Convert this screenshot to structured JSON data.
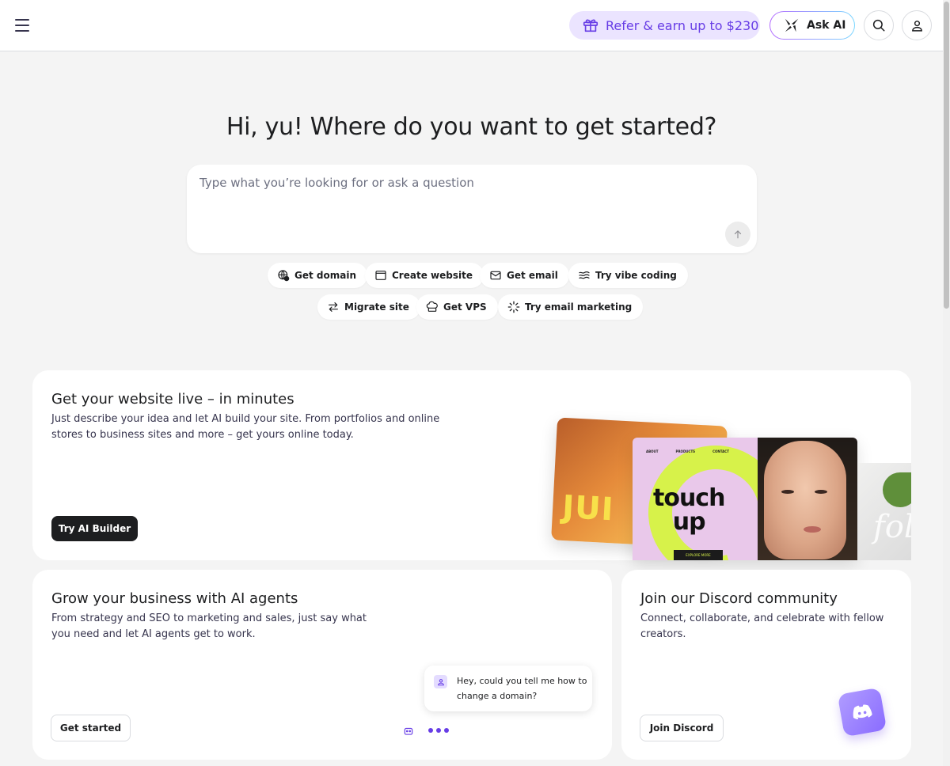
{
  "topbar": {
    "refer_label": "Refer & earn up to $230",
    "ask_ai_label": "Ask AI"
  },
  "hero": {
    "greeting": "Hi, yu! Where do you want to get started?",
    "ask_placeholder": "Type what you’re looking for or ask a question"
  },
  "quick_actions": [
    {
      "label": "Get domain",
      "icon": "globe-icon"
    },
    {
      "label": "Create website",
      "icon": "browser-window-icon"
    },
    {
      "label": "Get email",
      "icon": "mail-icon"
    },
    {
      "label": "Try vibe coding",
      "icon": "waves-icon"
    },
    {
      "label": "Migrate site",
      "icon": "swap-arrows-icon"
    },
    {
      "label": "Get VPS",
      "icon": "cloud-server-icon"
    },
    {
      "label": "Try email marketing",
      "icon": "sparkle-loader-icon"
    }
  ],
  "cards": {
    "website": {
      "title": "Get your website live – in minutes",
      "desc_line1": "Just describe your idea and let AI build your site. From portfolios and online",
      "desc_line2": "stores to business sites and more – get yours online today.",
      "button": "Try AI Builder",
      "preview": {
        "nav_about": "ABOUT",
        "nav_products": "PRODUCTS",
        "nav_contact": "CONTACT",
        "headline_1": "touch",
        "headline_2": "up",
        "cta": "EXPLORE MORE",
        "juice_text": "JUI",
        "folio_text": "foli"
      }
    },
    "agents": {
      "title": "Grow your business with AI agents",
      "desc_line1": "From strategy and SEO to marketing and sales, just say what",
      "desc_line2": "you need and let AI agents get to work.",
      "button": "Get started",
      "chat_text": "Hey, could you tell me how to change a domain?"
    },
    "discord": {
      "title": "Join our Discord community",
      "desc_line1": "Connect, collaborate, and celebrate with fellow",
      "desc_line2": "creators.",
      "button": "Join Discord"
    }
  },
  "colors": {
    "accent": "#673de6",
    "accent_light": "#ebe4ff",
    "dark_button": "#1d1e20",
    "background": "#f4f4f4"
  }
}
